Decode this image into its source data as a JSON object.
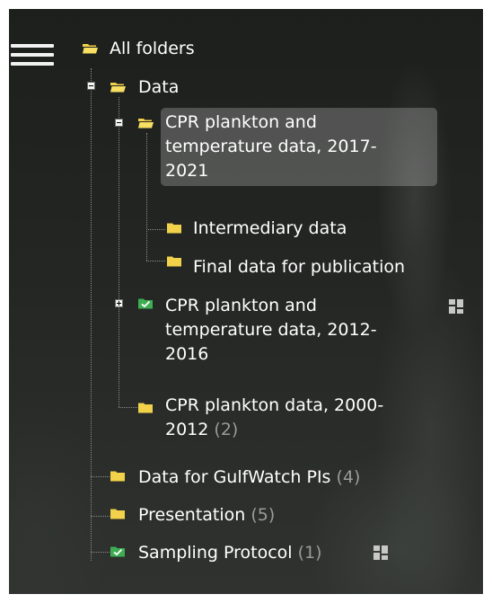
{
  "colors": {
    "folder": "#f2d24a",
    "shared_folder": "#3fae52",
    "count_text": "#9a9a9a",
    "selection": "#5d5f5d"
  },
  "menu": {
    "icon": "hamburger-menu-icon"
  },
  "tree": {
    "root": {
      "label": "All folders",
      "icon": "folder-open-icon"
    },
    "data": {
      "label": "Data",
      "icon": "folder-open-icon",
      "state": "expanded"
    },
    "cpr_2017": {
      "line1": "CPR plankton and",
      "line2": "temperature data, 2017-",
      "line3": "2021",
      "icon": "folder-open-icon",
      "state": "expanded",
      "selected": true
    },
    "intermediary": {
      "label": "Intermediary data",
      "icon": "folder-icon"
    },
    "final": {
      "label": "Final data for publication",
      "icon": "folder-icon"
    },
    "cpr_2012": {
      "line1": "CPR plankton and",
      "line2": "temperature data, 2012-",
      "line3": "2016",
      "icon": "shared-folder-icon",
      "state": "collapsed",
      "action_icon": "grid-icon"
    },
    "cpr_2000": {
      "line1": "CPR plankton data, 2000-",
      "line2": "2012",
      "count": "(2)",
      "icon": "folder-icon"
    },
    "gulfwatch": {
      "label": "Data for GulfWatch PIs",
      "count": "(4)",
      "icon": "folder-icon"
    },
    "presentation": {
      "label": "Presentation",
      "count": "(5)",
      "icon": "folder-icon"
    },
    "sampling": {
      "label": "Sampling Protocol",
      "count": "(1)",
      "icon": "shared-folder-icon",
      "action_icon": "grid-icon"
    }
  }
}
